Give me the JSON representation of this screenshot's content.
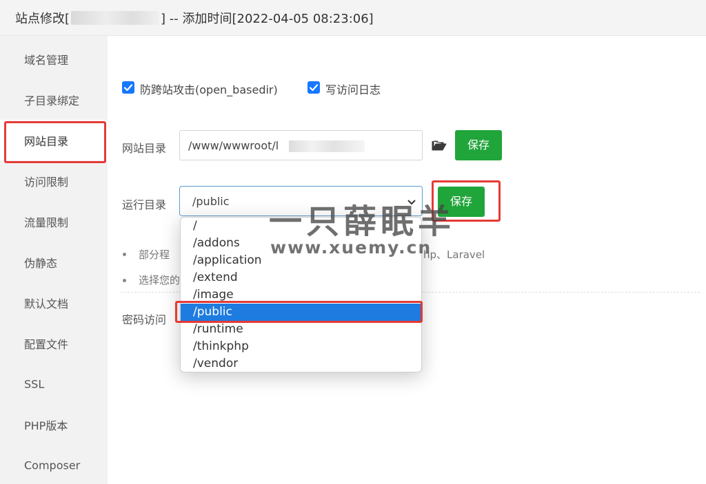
{
  "titlebar": {
    "prefix": "站点修改[",
    "suffix": "] -- 添加时间[2022-04-05 08:23:06]"
  },
  "sidebar": {
    "items": [
      {
        "label": "域名管理"
      },
      {
        "label": "子目录绑定"
      },
      {
        "label": "网站目录"
      },
      {
        "label": "访问限制"
      },
      {
        "label": "流量限制"
      },
      {
        "label": "伪静态"
      },
      {
        "label": "默认文档"
      },
      {
        "label": "配置文件"
      },
      {
        "label": "SSL"
      },
      {
        "label": "PHP版本"
      },
      {
        "label": "Composer"
      }
    ],
    "active_index": 2
  },
  "options": {
    "anti_xss": {
      "label": "防跨站攻击(open_basedir)",
      "checked": true
    },
    "access_log": {
      "label": "写访问日志",
      "checked": true
    }
  },
  "site_dir": {
    "label": "网站目录",
    "value": "/www/wwwroot/l",
    "folder_icon": "folder-open-icon",
    "save_label": "保存"
  },
  "run_dir": {
    "label": "运行目录",
    "selected": "/public",
    "save_label": "保存",
    "options": [
      "/",
      "/addons",
      "/application",
      "/extend",
      "/image",
      "/public",
      "/runtime",
      "/thinkphp",
      "/vendor"
    ]
  },
  "tips": [
    {
      "start": "部分程",
      "end": "hp、Laravel"
    },
    {
      "start": "选择您的",
      "end": ""
    }
  ],
  "password_access": {
    "label": "密码访问"
  },
  "watermark": {
    "title": "一只薛眠羊",
    "url": "www.xuemy.cn"
  },
  "colors": {
    "accent_green": "#20a53a",
    "checkbox_blue": "#1677ff",
    "selected_blue": "#1e7be0",
    "highlight_red": "#e53935"
  }
}
